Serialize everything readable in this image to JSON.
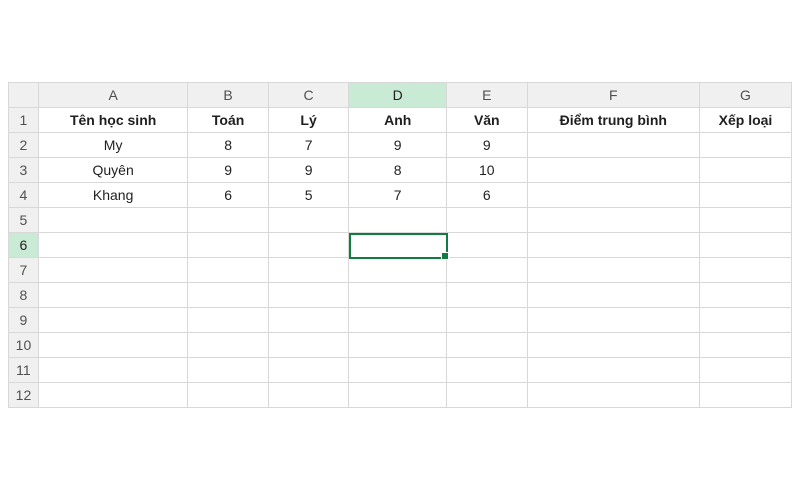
{
  "columns": [
    {
      "letter": "A",
      "width": 130
    },
    {
      "letter": "B",
      "width": 70
    },
    {
      "letter": "C",
      "width": 70
    },
    {
      "letter": "D",
      "width": 85
    },
    {
      "letter": "E",
      "width": 70
    },
    {
      "letter": "F",
      "width": 150
    },
    {
      "letter": "G",
      "width": 80
    }
  ],
  "rowCount": 12,
  "headerRow": [
    "Tên học sinh",
    "Toán",
    "Lý",
    "Anh",
    "Văn",
    "Điểm trung bình",
    "Xếp loại"
  ],
  "dataRows": [
    [
      "My",
      "8",
      "7",
      "9",
      "9",
      "",
      ""
    ],
    [
      "Quyên",
      "9",
      "9",
      "8",
      "10",
      "",
      ""
    ],
    [
      "Khang",
      "6",
      "5",
      "7",
      "6",
      "",
      ""
    ]
  ],
  "activeCell": {
    "col": "D",
    "row": 6
  },
  "colors": {
    "grid": "#d8d8d8",
    "headerBg": "#f0f0f0",
    "selHeaderBg": "#c9ead5",
    "selBorder": "#107c41"
  }
}
